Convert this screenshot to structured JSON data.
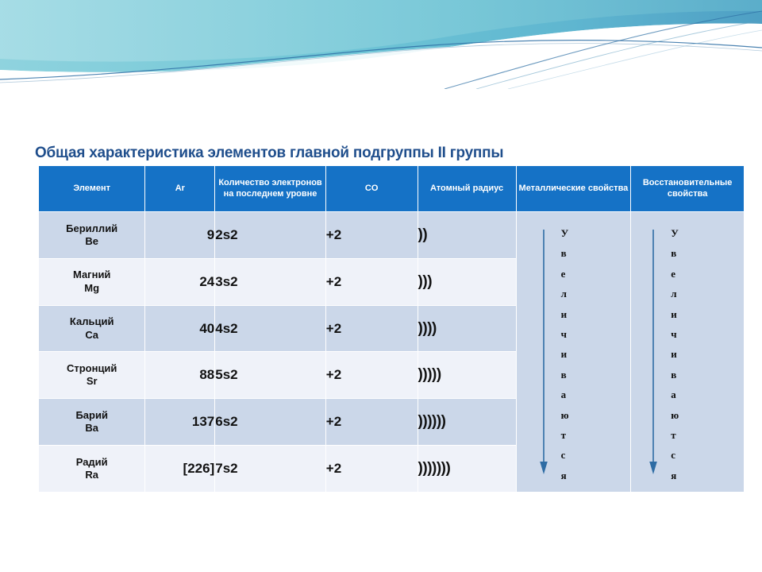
{
  "slide": {
    "title": "Общая характеристика элементов главной подгруппы II группы",
    "title_color": "#1F4E8C",
    "header_fill": "#1572C6",
    "row_odd_fill": "#CBD7E9",
    "row_even_fill": "#EFF2F9",
    "arrow_color": "#2E6CA4",
    "banner_color": "#6FC5D6"
  },
  "table": {
    "headers": [
      "Элемент",
      "Ar",
      "Количество электронов на последнем уровне",
      "CO",
      "Атомный радиус",
      "Металлические свойства",
      "Восстановительные свойства"
    ],
    "rows": [
      {
        "name_ru": "Бериллий",
        "symbol": "Be",
        "ar": "9",
        "config": "2s2",
        "co": "+2",
        "radius": "))"
      },
      {
        "name_ru": "Магний",
        "symbol": "Mg",
        "ar": "24",
        "config": "3s2",
        "co": "+2",
        "radius": ")))"
      },
      {
        "name_ru": "Кальций",
        "symbol": "Ca",
        "ar": "40",
        "config": "4s2",
        "co": "+2",
        "radius": "))))"
      },
      {
        "name_ru": "Стронций",
        "symbol": "Sr",
        "ar": "88",
        "config": "5s2",
        "co": "+2",
        "radius": ")))))"
      },
      {
        "name_ru": "Барий",
        "symbol": "Ba",
        "ar": "137",
        "config": "6s2",
        "co": "+2",
        "radius": "))))))"
      },
      {
        "name_ru": "Радий",
        "symbol": "Ra",
        "ar": "[226]",
        "config": "7s2",
        "co": "+2",
        "radius": ")))))))"
      }
    ],
    "trends": {
      "metallic": {
        "word": "Увеличиваются",
        "letters": [
          "У",
          "в",
          "е",
          "л",
          "и",
          "ч",
          "и",
          "в",
          "а",
          "ю",
          "т",
          "с",
          "я"
        ],
        "arrow": "down-arrow-icon"
      },
      "reducing": {
        "word": "Увеличиваются",
        "letters": [
          "У",
          "в",
          "е",
          "л",
          "и",
          "ч",
          "и",
          "в",
          "а",
          "ю",
          "т",
          "с",
          "я"
        ],
        "arrow": "down-arrow-icon"
      }
    }
  }
}
